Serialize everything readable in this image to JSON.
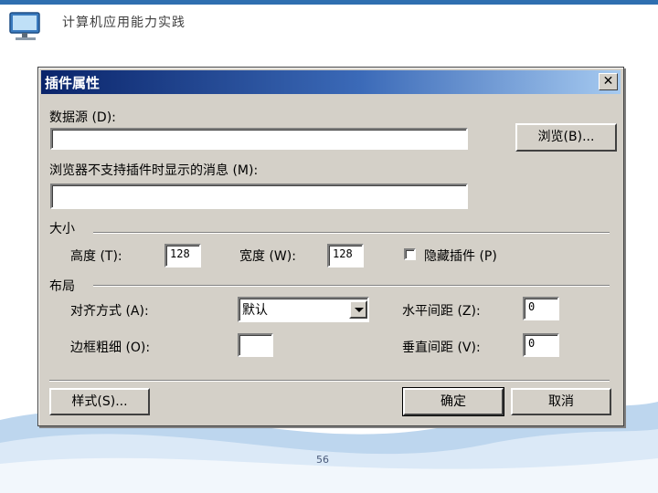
{
  "slide": {
    "title": "计算机应用能力实践",
    "page_number": "56"
  },
  "dialog": {
    "title": "插件属性",
    "close_glyph": "✕",
    "data_source_label": "数据源 (D):",
    "data_source_value": "",
    "browse_button": "浏览(B)...",
    "message_label": "浏览器不支持插件时显示的消息 (M):",
    "message_value": "",
    "size_group": "大小",
    "height_label": "高度 (T):",
    "height_value": "128",
    "width_label": "宽度 (W):",
    "width_value": "128",
    "hide_plugin_label": "隐藏插件 (P)",
    "hide_plugin_checked": false,
    "layout_group": "布局",
    "align_label": "对齐方式 (A):",
    "align_value": "默认",
    "hspace_label": "水平间距 (Z):",
    "hspace_value": "0",
    "border_label": "边框粗细 (O):",
    "border_value": "",
    "vspace_label": "垂直间距 (V):",
    "vspace_value": "0",
    "style_button": "样式(S)...",
    "ok_button": "确定",
    "cancel_button": "取消"
  }
}
